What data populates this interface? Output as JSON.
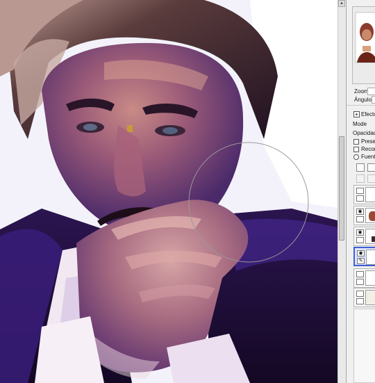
{
  "canvas": {
    "subject": "portrait painting"
  },
  "navigator": {
    "zoom_label": "Zoom",
    "angle_label": "Ángulo"
  },
  "layer_panel": {
    "effects_label": "Efector",
    "mode_label": "Mode",
    "opacity_label": "Opacidad",
    "preserve_label": "Preserv",
    "clip_label": "Recort",
    "source_label": "Fuente"
  },
  "colors": {
    "accent": "#3c5fd6",
    "brush_cursor": "#9a9a9a"
  }
}
